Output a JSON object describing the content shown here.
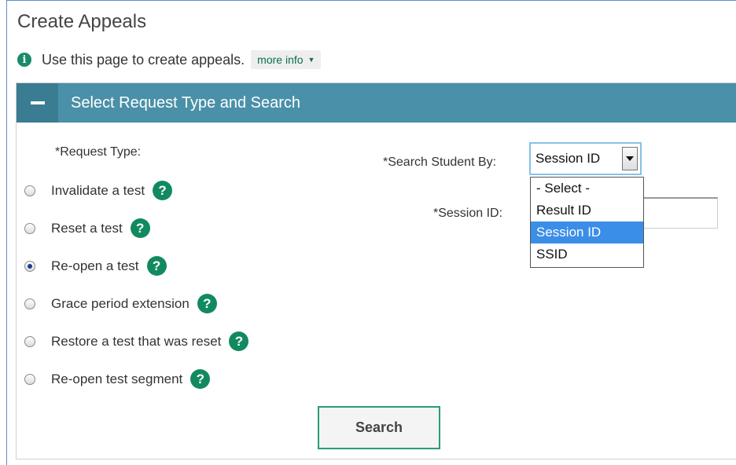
{
  "page": {
    "title": "Create Appeals",
    "info_text": "Use this page to create appeals.",
    "more_info_label": "more info"
  },
  "panel": {
    "title": "Select Request Type and Search",
    "request_type_label": "*Request Type:",
    "request_types": [
      {
        "label": "Invalidate a test",
        "checked": false
      },
      {
        "label": "Reset a test",
        "checked": false
      },
      {
        "label": "Re-open a test",
        "checked": true
      },
      {
        "label": "Grace period extension",
        "checked": false
      },
      {
        "label": "Restore a test that was reset",
        "checked": false
      },
      {
        "label": "Re-open test segment",
        "checked": false
      }
    ],
    "search_by_label": "*Search Student By:",
    "search_by_value": "Session ID",
    "search_by_options": [
      "- Select -",
      "Result ID",
      "Session ID",
      "SSID"
    ],
    "session_id_label": "*Session ID:",
    "session_id_value": "",
    "search_button": "Search"
  },
  "colors": {
    "header_bg": "#4a90a8",
    "accent_green": "#128a5f",
    "selected_option": "#3b8ee8"
  }
}
